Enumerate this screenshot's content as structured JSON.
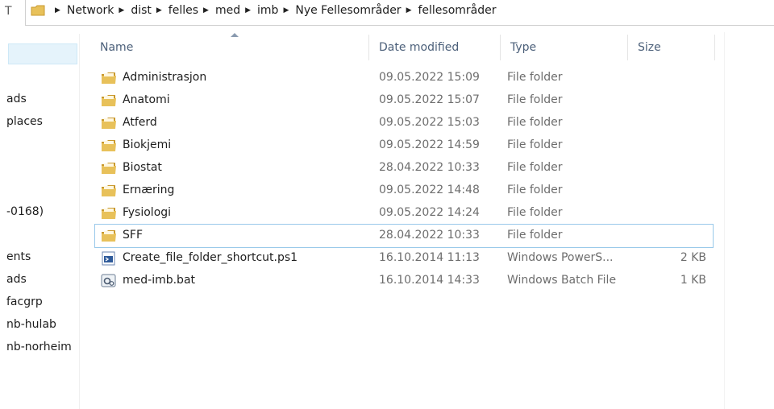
{
  "window": {
    "up_glyph": "T"
  },
  "address_bar": {
    "crumbs": [
      "Network",
      "dist",
      "felles",
      "med",
      "imb",
      "Nye Fellesområder",
      "fellesområder"
    ]
  },
  "nav_pane": {
    "items": [
      "",
      "ads",
      "places",
      "-0168)",
      "",
      "ents",
      "ads",
      "facgrp",
      "nb-hulab",
      "nb-norheim",
      ""
    ]
  },
  "columns": {
    "name": "Name",
    "date": "Date modified",
    "type": "Type",
    "size": "Size"
  },
  "files": [
    {
      "name": "Administrasjon",
      "date": "09.05.2022 15:09",
      "type": "File folder",
      "size": "",
      "icon": "folder-icon"
    },
    {
      "name": "Anatomi",
      "date": "09.05.2022 15:07",
      "type": "File folder",
      "size": "",
      "icon": "folder-icon"
    },
    {
      "name": "Atferd",
      "date": "09.05.2022 15:03",
      "type": "File folder",
      "size": "",
      "icon": "folder-icon"
    },
    {
      "name": "Biokjemi",
      "date": "09.05.2022 14:59",
      "type": "File folder",
      "size": "",
      "icon": "folder-icon"
    },
    {
      "name": "Biostat",
      "date": "28.04.2022 10:33",
      "type": "File folder",
      "size": "",
      "icon": "folder-icon"
    },
    {
      "name": "Ernæring",
      "date": "09.05.2022 14:48",
      "type": "File folder",
      "size": "",
      "icon": "folder-icon"
    },
    {
      "name": "Fysiologi",
      "date": "09.05.2022 14:24",
      "type": "File folder",
      "size": "",
      "icon": "folder-icon"
    },
    {
      "name": "SFF",
      "date": "28.04.2022 10:33",
      "type": "File folder",
      "size": "",
      "icon": "folder-icon",
      "focused": true
    },
    {
      "name": "Create_file_folder_shortcut.ps1",
      "date": "16.10.2014 11:13",
      "type": "Windows PowerS...",
      "size": "2 KB",
      "icon": "powershell-script-icon"
    },
    {
      "name": "med-imb.bat",
      "date": "16.10.2014 14:33",
      "type": "Windows Batch File",
      "size": "1 KB",
      "icon": "batch-file-icon"
    }
  ],
  "colors": {
    "folder": "#e8c15a",
    "folder_dark": "#c9992e",
    "header_text": "#4c607a",
    "selection": "#e5f3fb",
    "focus_border": "#99c9ea"
  }
}
